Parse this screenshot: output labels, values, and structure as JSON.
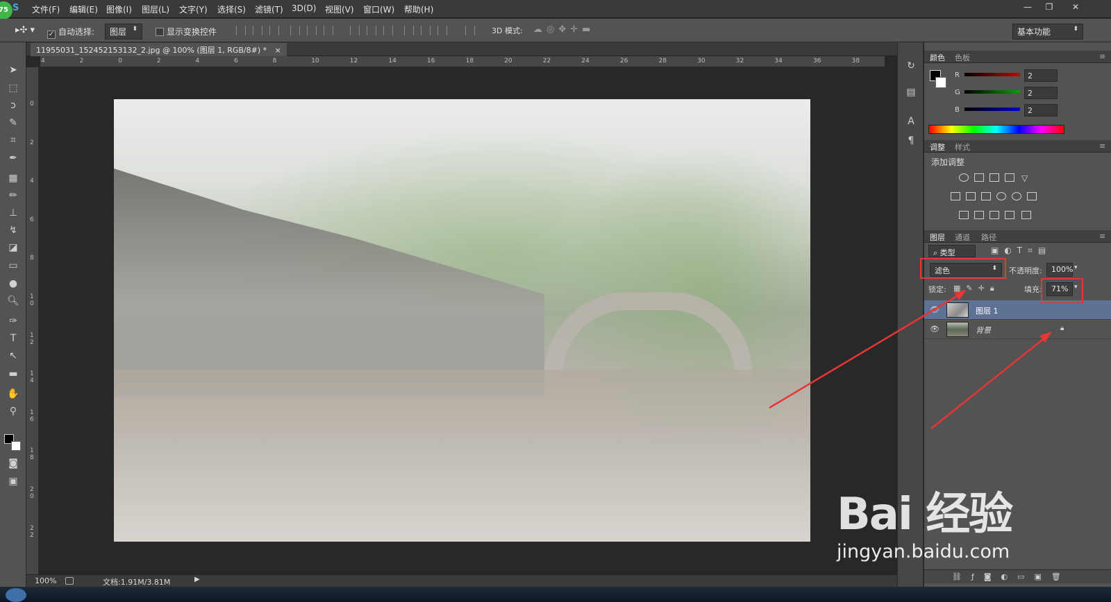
{
  "app": {
    "logo_text": "75",
    "logo_suffix": "S"
  },
  "menu": [
    "文件(F)",
    "编辑(E)",
    "图像(I)",
    "图层(L)",
    "文字(Y)",
    "选择(S)",
    "滤镜(T)",
    "3D(D)",
    "视图(V)",
    "窗口(W)",
    "帮助(H)"
  ],
  "window_controls": {
    "minimize": "—",
    "restore": "❐",
    "close": "✕"
  },
  "options_bar": {
    "auto_select_label": "自动选择:",
    "auto_select_checked": "✓",
    "auto_select_target": "图层",
    "show_transform_label": "显示变换控件",
    "mode_3d_label": "3D 模式:",
    "workspace": "基本功能"
  },
  "document": {
    "tab_title": "11955031_152452153132_2.jpg @ 100% (图层 1, RGB/8#) *",
    "close": "×"
  },
  "ruler_h": [
    "4",
    "2",
    "0",
    "2",
    "4",
    "6",
    "8",
    "10",
    "12",
    "14",
    "16",
    "18",
    "20",
    "22",
    "24",
    "26",
    "28",
    "30",
    "32",
    "34",
    "36",
    "38"
  ],
  "ruler_v": [
    "0",
    "2",
    "4",
    "6",
    "8",
    "1 0",
    "1 2",
    "1 4",
    "1 6",
    "1 8",
    "2 0",
    "2 2"
  ],
  "status": {
    "zoom": "100%",
    "doc_info": "文档:1.91M/3.81M"
  },
  "color_panel": {
    "tabs": [
      "颜色",
      "色板"
    ],
    "r": "2",
    "g": "2",
    "b": "2",
    "r_label": "R",
    "g_label": "G",
    "b_label": "B"
  },
  "adjust_panel": {
    "tabs": [
      "调整",
      "样式"
    ],
    "title": "添加调整"
  },
  "layers_panel": {
    "tabs": [
      "图层",
      "通道",
      "路径"
    ],
    "filter_kind": "类型",
    "blend_mode": "滤色",
    "opacity_label": "不透明度:",
    "opacity": "100%",
    "lock_label": "锁定:",
    "fill_label": "填充:",
    "fill": "71%",
    "layers": [
      {
        "name": "图层 1",
        "selected": true
      },
      {
        "name": "背景",
        "selected": false
      }
    ]
  },
  "watermark": {
    "logo": "Bai 经验",
    "url": "jingyan.baidu.com"
  },
  "colors": {
    "accent_red": "#e83535",
    "layer_selected": "#5d7295",
    "r_slider": "#c80000",
    "g_slider": "#00a000",
    "b_slider": "#0000c8"
  }
}
